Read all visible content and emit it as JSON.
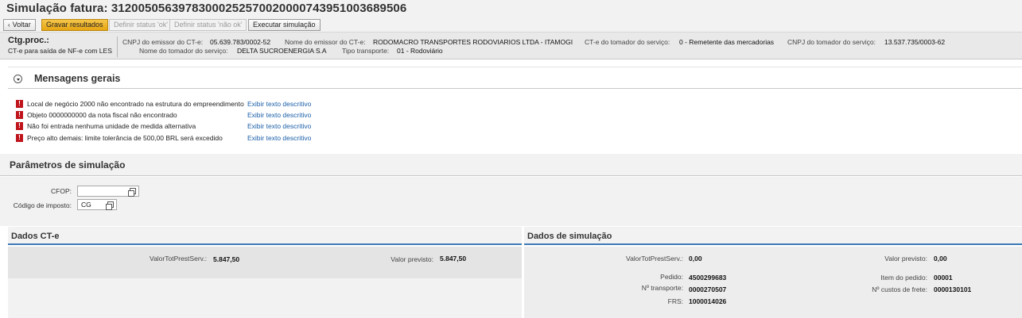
{
  "page_title": "Simulação fatura: 31200505639783000252570020000743951003689506",
  "toolbar": {
    "back_label": "Voltar",
    "save_results_label": "Gravar resultados",
    "set_status_ok_label": "Definir status 'ok'",
    "set_status_not_ok_label": "Definir status 'não ok'",
    "run_simulation_label": "Executar simulação"
  },
  "header": {
    "category_label": "Ctg.proc.:",
    "category_value": "CT-e para saída de NF-e com LES",
    "fields": [
      {
        "label": "CNPJ do emissor do CT-e:",
        "value": "05.639.783/0002-52"
      },
      {
        "label": "Nome do emissor do CT-e:",
        "value": "RODOMACRO TRANSPORTES RODOVIARIOS LTDA - ITAMOGI"
      },
      {
        "label": "CT-e do tomador do serviço:",
        "value": "0 - Remetente das mercadorias"
      },
      {
        "label": "CNPJ do tomador do serviço:",
        "value": "13.537.735/0003-62"
      },
      {
        "label": "Nome do tomador do serviço:",
        "value": "DELTA SUCROENERGIA S.A"
      },
      {
        "label": "Tipo transporte:",
        "value": "01 - Rodoviário"
      }
    ]
  },
  "messages": {
    "title": "Mensagens gerais",
    "link_label": "Exibir texto descritivo",
    "items": [
      {
        "text": "Local de negócio 2000  não encontrado na estrutura do empreendimento"
      },
      {
        "text": "Objeto 0000000000 da nota fiscal não encontrado"
      },
      {
        "text": "Não foi entrada nenhuma unidade de medida alternativa"
      },
      {
        "text": "Preço alto demais: limite tolerância de 500,00 BRL será excedido"
      }
    ]
  },
  "parameters": {
    "title": "Parâmetros de simulação",
    "cfop_label": "CFOP:",
    "cfop_value": "",
    "tax_code_label": "Código de imposto:",
    "tax_code_value": "CG"
  },
  "dados_cte": {
    "title": "Dados CT-e",
    "valor_tot_label": "ValorTotPrestServ.:",
    "valor_tot_value": "5.847,50",
    "valor_previsto_label": "Valor previsto:",
    "valor_previsto_value": "5.847,50"
  },
  "dados_simulacao": {
    "title": "Dados de simulação",
    "valor_tot_label": "ValorTotPrestServ.:",
    "valor_tot_value": "0,00",
    "valor_previsto_label": "Valor previsto:",
    "valor_previsto_value": "0,00",
    "pedido_label": "Pedido:",
    "pedido_value": "4500299683",
    "item_pedido_label": "Item do pedido:",
    "item_pedido_value": "00001",
    "transporte_label": "Nº transporte:",
    "transporte_value": "0000270507",
    "custos_frete_label": "Nº custos de frete:",
    "custos_frete_value": "0000130101",
    "frs_label": "FRS:",
    "frs_value": "1000014026"
  },
  "colors": {
    "primary_button": "#e6a513",
    "error_icon": "#c0141c",
    "link": "#1a5ea8",
    "section_underline": "#3b79b5"
  }
}
